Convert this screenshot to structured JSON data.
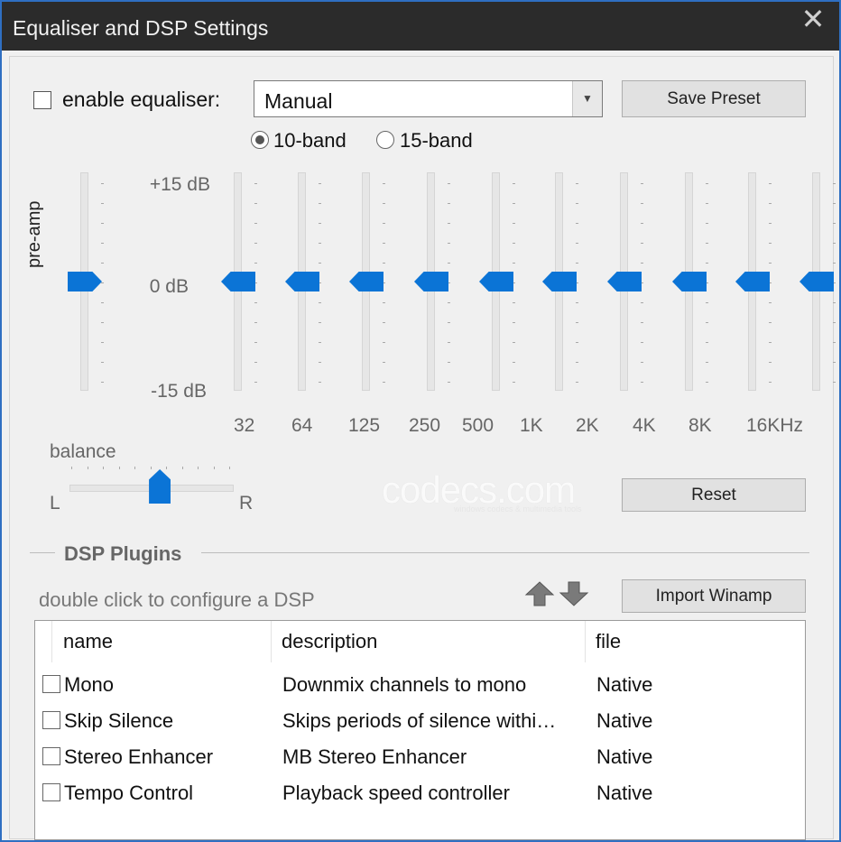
{
  "window": {
    "title": "Equaliser and DSP Settings",
    "close_glyph": "✕"
  },
  "equaliser": {
    "enable_label": "enable equaliser:",
    "enabled": false,
    "preset": "Manual",
    "save_preset_label": "Save Preset",
    "reset_label": "Reset",
    "band_modes": [
      {
        "label": "10-band",
        "selected": true
      },
      {
        "label": "15-band",
        "selected": false
      }
    ],
    "db_labels": {
      "top": "+15 dB",
      "mid": "0 dB",
      "bottom": "-15 dB"
    },
    "preamp_label": "pre-amp",
    "preamp_db": 0,
    "bands": [
      {
        "label": "32",
        "gain_db": 0
      },
      {
        "label": "64",
        "gain_db": 0
      },
      {
        "label": "125",
        "gain_db": 0
      },
      {
        "label": "250",
        "gain_db": 0
      },
      {
        "label": "500",
        "gain_db": 0
      },
      {
        "label": "1K",
        "gain_db": 0
      },
      {
        "label": "2K",
        "gain_db": 0
      },
      {
        "label": "4K",
        "gain_db": 0
      },
      {
        "label": "8K",
        "gain_db": 0
      },
      {
        "label": "16KHz",
        "gain_db": 0
      }
    ],
    "balance": {
      "label": "balance",
      "left_label": "L",
      "right_label": "R",
      "value": 0.55
    }
  },
  "watermark": {
    "text": "codecs.com",
    "subtext": "windows codecs & multimedia tools"
  },
  "dsp": {
    "section_title": "DSP Plugins",
    "hint": "double click to configure a DSP",
    "import_label": "Import Winamp",
    "columns": [
      "name",
      "description",
      "file"
    ],
    "plugins": [
      {
        "name": "Mono",
        "description": "Downmix channels to mono",
        "file": "Native",
        "enabled": false
      },
      {
        "name": "Skip Silence",
        "description": "Skips periods of silence withi…",
        "file": "Native",
        "enabled": false
      },
      {
        "name": "Stereo Enhancer",
        "description": "MB Stereo Enhancer",
        "file": "Native",
        "enabled": false
      },
      {
        "name": "Tempo Control",
        "description": "Playback speed controller",
        "file": "Native",
        "enabled": false
      }
    ]
  },
  "colors": {
    "accent": "#0b74d6",
    "titlebar": "#2b2b2b",
    "window_border": "#2f6fc2"
  }
}
